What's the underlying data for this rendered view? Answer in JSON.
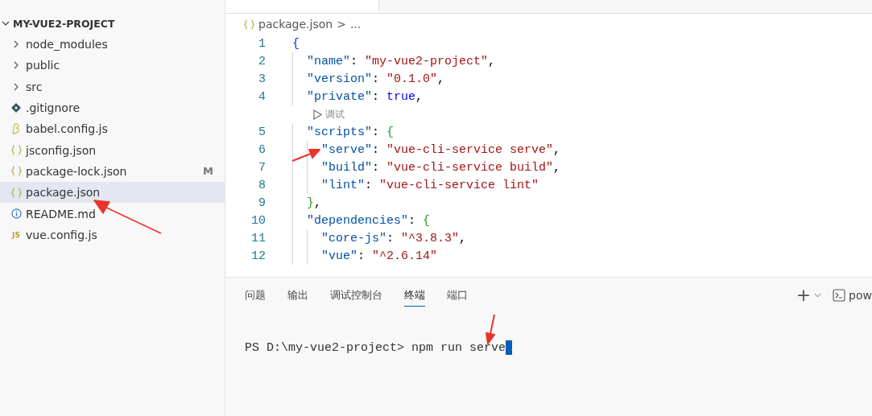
{
  "explorer": {
    "root": {
      "label": "MY-VUE2-PROJECT",
      "expanded": true
    },
    "items": [
      {
        "label": "node_modules",
        "kind": "folder",
        "selected": false
      },
      {
        "label": "public",
        "kind": "folder",
        "selected": false
      },
      {
        "label": "src",
        "kind": "folder",
        "selected": false
      },
      {
        "label": ".gitignore",
        "kind": "git",
        "selected": false
      },
      {
        "label": "babel.config.js",
        "kind": "babel",
        "selected": false
      },
      {
        "label": "jsconfig.json",
        "kind": "json",
        "selected": false
      },
      {
        "label": "package-lock.json",
        "kind": "json",
        "selected": false,
        "badge": "M"
      },
      {
        "label": "package.json",
        "kind": "json",
        "selected": true
      },
      {
        "label": "README.md",
        "kind": "info",
        "selected": false
      },
      {
        "label": "vue.config.js",
        "kind": "js",
        "selected": false,
        "icon_text": "JS"
      }
    ]
  },
  "editor": {
    "breadcrumb": {
      "file": "package.json",
      "separator": ">",
      "rest": "..."
    },
    "lines": [
      {
        "kind": "code",
        "no": "1",
        "tokens": [
          {
            "t": "{",
            "kind": "brace1"
          }
        ]
      },
      {
        "kind": "code",
        "no": "2",
        "tokens": [
          {
            "t": "  \"name\"",
            "kind": "key"
          },
          {
            "t": ": ",
            "kind": "punct"
          },
          {
            "t": "\"my-vue2-project\"",
            "kind": "str"
          },
          {
            "t": ",",
            "kind": "punct"
          }
        ]
      },
      {
        "kind": "code",
        "no": "3",
        "tokens": [
          {
            "t": "  \"version\"",
            "kind": "key"
          },
          {
            "t": ": ",
            "kind": "punct"
          },
          {
            "t": "\"0.1.0\"",
            "kind": "str"
          },
          {
            "t": ",",
            "kind": "punct"
          }
        ]
      },
      {
        "kind": "code",
        "no": "4",
        "tokens": [
          {
            "t": "  \"private\"",
            "kind": "key"
          },
          {
            "t": ": ",
            "kind": "punct"
          },
          {
            "t": "true",
            "kind": "bool"
          },
          {
            "t": ",",
            "kind": "punct"
          }
        ]
      },
      {
        "kind": "lens",
        "text": "调试"
      },
      {
        "kind": "code",
        "no": "5",
        "tokens": [
          {
            "t": "  \"scripts\"",
            "kind": "key"
          },
          {
            "t": ": ",
            "kind": "punct"
          },
          {
            "t": "{",
            "kind": "brace2"
          }
        ]
      },
      {
        "kind": "code",
        "no": "6",
        "tokens": [
          {
            "t": "    \"serve\"",
            "kind": "key"
          },
          {
            "t": ": ",
            "kind": "punct"
          },
          {
            "t": "\"vue-cli-service serve\"",
            "kind": "str"
          },
          {
            "t": ",",
            "kind": "punct"
          }
        ]
      },
      {
        "kind": "code",
        "no": "7",
        "tokens": [
          {
            "t": "    \"build\"",
            "kind": "key"
          },
          {
            "t": ": ",
            "kind": "punct"
          },
          {
            "t": "\"vue-cli-service build\"",
            "kind": "str"
          },
          {
            "t": ",",
            "kind": "punct"
          }
        ]
      },
      {
        "kind": "code",
        "no": "8",
        "tokens": [
          {
            "t": "    \"lint\"",
            "kind": "key"
          },
          {
            "t": ": ",
            "kind": "punct"
          },
          {
            "t": "\"vue-cli-service lint\"",
            "kind": "str"
          }
        ]
      },
      {
        "kind": "code",
        "no": "9",
        "tokens": [
          {
            "t": "  }",
            "kind": "brace2"
          },
          {
            "t": ",",
            "kind": "punct"
          }
        ]
      },
      {
        "kind": "code",
        "no": "10",
        "tokens": [
          {
            "t": "  \"dependencies\"",
            "kind": "key"
          },
          {
            "t": ": ",
            "kind": "punct"
          },
          {
            "t": "{",
            "kind": "brace2"
          }
        ]
      },
      {
        "kind": "code",
        "no": "11",
        "tokens": [
          {
            "t": "    \"core-js\"",
            "kind": "key"
          },
          {
            "t": ": ",
            "kind": "punct"
          },
          {
            "t": "\"^3.8.3\"",
            "kind": "str"
          },
          {
            "t": ",",
            "kind": "punct"
          }
        ]
      },
      {
        "kind": "code",
        "no": "12",
        "tokens": [
          {
            "t": "    \"vue\"",
            "kind": "key"
          },
          {
            "t": ": ",
            "kind": "punct"
          },
          {
            "t": "\"^2.6.14\"",
            "kind": "str"
          }
        ]
      }
    ]
  },
  "panel": {
    "tabs": [
      {
        "label": "问题",
        "selected": false
      },
      {
        "label": "输出",
        "selected": false
      },
      {
        "label": "调试控制台",
        "selected": false
      },
      {
        "label": "终端",
        "selected": true
      },
      {
        "label": "端口",
        "selected": false
      }
    ],
    "actions": {
      "add": "+",
      "shell": "pow"
    },
    "terminal": {
      "prompt": "PS D:\\my-vue2-project> ",
      "command": "npm run serve"
    }
  }
}
